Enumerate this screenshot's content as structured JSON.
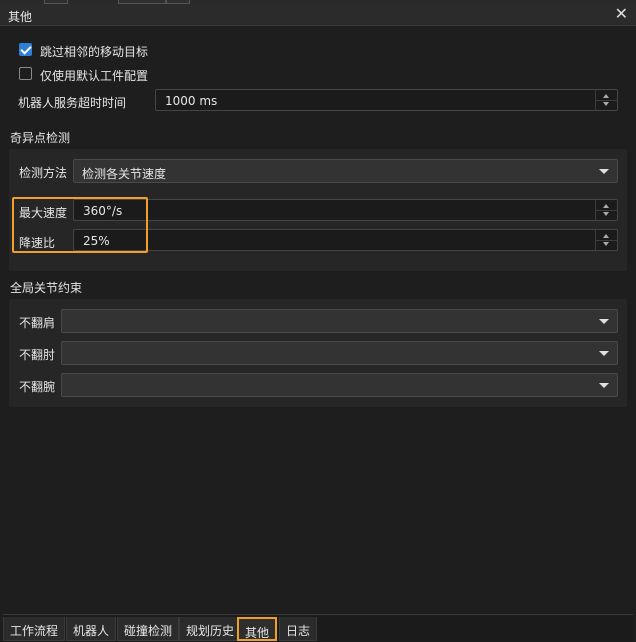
{
  "window": {
    "title": "其他",
    "close_glyph": "✕"
  },
  "options": {
    "skip_adjacent": {
      "label": "跳过相邻的移动目标",
      "checked": true
    },
    "default_config": {
      "label": "仅使用默认工件配置",
      "checked": false
    },
    "timeout": {
      "label": "机器人服务超时时间",
      "value": "1000 ms"
    }
  },
  "singularity": {
    "title": "奇异点检测",
    "method": {
      "label": "检测方法",
      "value": "检测各关节速度"
    },
    "max_speed": {
      "label": "最大速度",
      "value": "360°/s"
    },
    "ratio": {
      "label": "降速比",
      "value": "25%"
    }
  },
  "joint_constraints": {
    "title": "全局关节约束",
    "shoulder": {
      "label": "不翻肩",
      "value": ""
    },
    "elbow": {
      "label": "不翻肘",
      "value": ""
    },
    "wrist": {
      "label": "不翻腕",
      "value": ""
    }
  },
  "tabs": [
    {
      "label": "工作流程",
      "active": false
    },
    {
      "label": "机器人",
      "active": false
    },
    {
      "label": "碰撞检测",
      "active": false
    },
    {
      "label": "规划历史",
      "active": false
    },
    {
      "label": "其他",
      "active": true
    },
    {
      "label": "日志",
      "active": false
    }
  ],
  "colors": {
    "accent": "#f0a028",
    "check": "#2f7fd6",
    "background": "#1e1e1e"
  },
  "icons": {
    "close": "close-icon",
    "dropdown": "chevron-down-icon",
    "spin": "spin-arrows-icon",
    "check": "checkmark-icon"
  }
}
